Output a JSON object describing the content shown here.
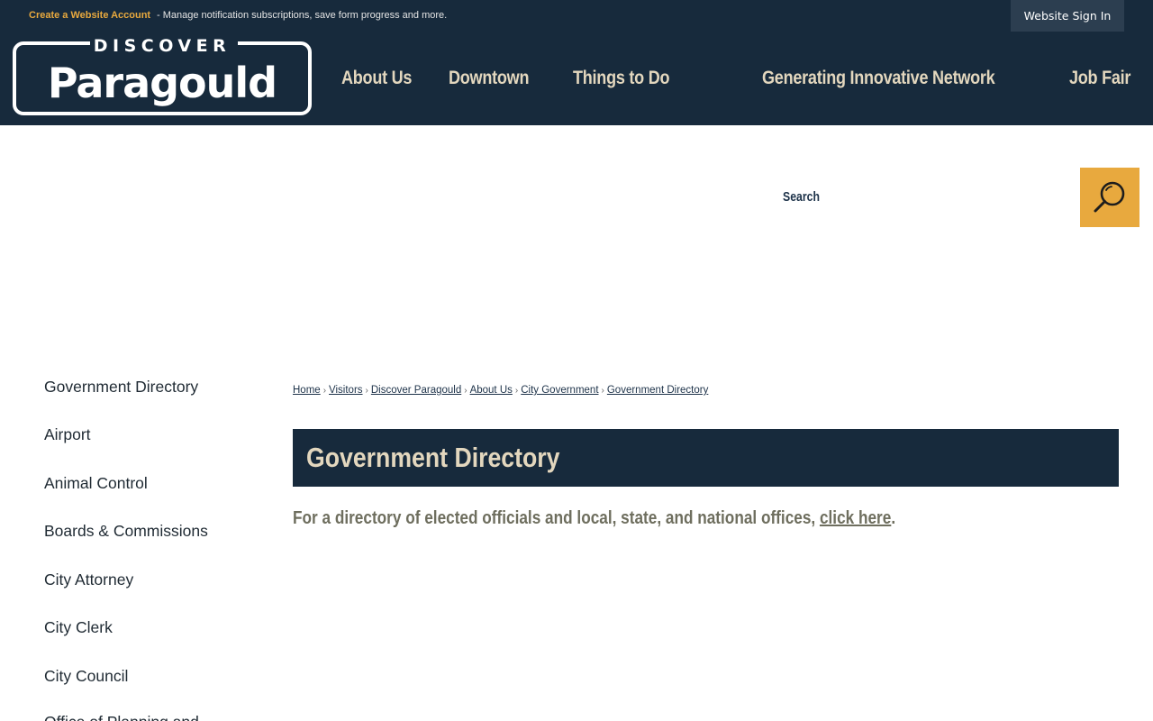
{
  "topbar": {
    "create_account": "Create a Website Account",
    "message": " - Manage notification subscriptions, save form progress and more.",
    "sign_in": "Website Sign In"
  },
  "logo": {
    "line1": "DISCOVER",
    "line2": "Paragould"
  },
  "nav": {
    "items": [
      "About Us",
      "Downtown",
      "Things to Do",
      "Generating Innovative Network",
      "Job Fair"
    ]
  },
  "search": {
    "label": "Search",
    "icon": "search-icon"
  },
  "sidebar": {
    "items": [
      "Government Directory",
      "Airport",
      "Animal Control",
      "Boards & Commissions",
      "City Attorney",
      "City Clerk",
      "City Council",
      "Office of Planning and"
    ]
  },
  "breadcrumb": {
    "items": [
      "Home",
      "Visitors",
      "Discover Paragould",
      "About Us",
      "City Government",
      "Government Directory"
    ],
    "separator": "›"
  },
  "page": {
    "title": "Government Directory",
    "intro_text": "For a directory of elected officials and local, state, and national offices, ",
    "intro_link": "click here",
    "intro_end": "."
  },
  "colors": {
    "navy": "#172a3c",
    "gold": "#e8a93e",
    "cream": "#e3d7be"
  }
}
